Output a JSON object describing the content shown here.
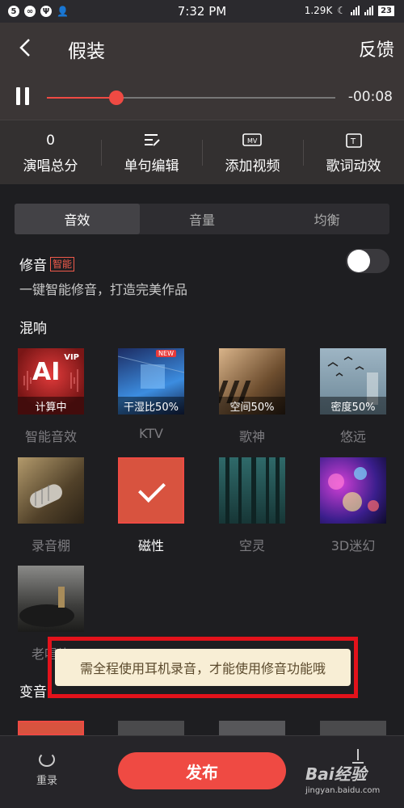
{
  "status_bar": {
    "time": "7:32 PM",
    "speed": "1.29K",
    "battery": "23"
  },
  "header": {
    "title": "假装",
    "feedback_label": "反馈",
    "progress": 0.24,
    "remaining_time": "-00:08"
  },
  "tools": [
    {
      "top": "0",
      "label": "演唱总分",
      "icon": "score-value"
    },
    {
      "top": "",
      "label": "单句编辑",
      "icon": "edit-lines-icon"
    },
    {
      "top": "",
      "label": "添加视频",
      "icon": "mv-icon"
    },
    {
      "top": "",
      "label": "歌词动效",
      "icon": "lyric-t-icon"
    }
  ],
  "tabs": [
    "音效",
    "音量",
    "均衡"
  ],
  "active_tab": 0,
  "auto_tune": {
    "label": "修音",
    "badge": "智能",
    "description": "一键智能修音，打造完美作品",
    "enabled": false
  },
  "reverb_section": "混响",
  "effects": [
    {
      "label": "智能音效",
      "caption": "计算中",
      "badge": "VIP",
      "overlay": "AI",
      "selected": false
    },
    {
      "label": "KTV",
      "caption": "干湿比50%",
      "badge": "NEW",
      "selected": false
    },
    {
      "label": "歌神",
      "caption": "空间50%",
      "selected": false
    },
    {
      "label": "悠远",
      "caption": "密度50%",
      "selected": false
    },
    {
      "label": "录音棚",
      "selected": false
    },
    {
      "label": "磁性",
      "selected": true
    },
    {
      "label": "空灵",
      "selected": false
    },
    {
      "label": "3D迷幻",
      "selected": false
    },
    {
      "label": "老唱片",
      "selected": false
    }
  ],
  "voice_section": "变音",
  "toast": "需全程使用耳机录音，才能使用修音功能哦",
  "bottom": {
    "rerecord_label": "重录",
    "publish_label": "发布",
    "watermark": "Bai经验",
    "watermark_url": "jingyan.baidu.com"
  },
  "colors": {
    "accent": "#ef4a43",
    "header_bg": "#3b3636",
    "body_bg": "#1e1e21",
    "toast_bg": "#f8eed5",
    "highlight_frame": "#e3121b"
  }
}
